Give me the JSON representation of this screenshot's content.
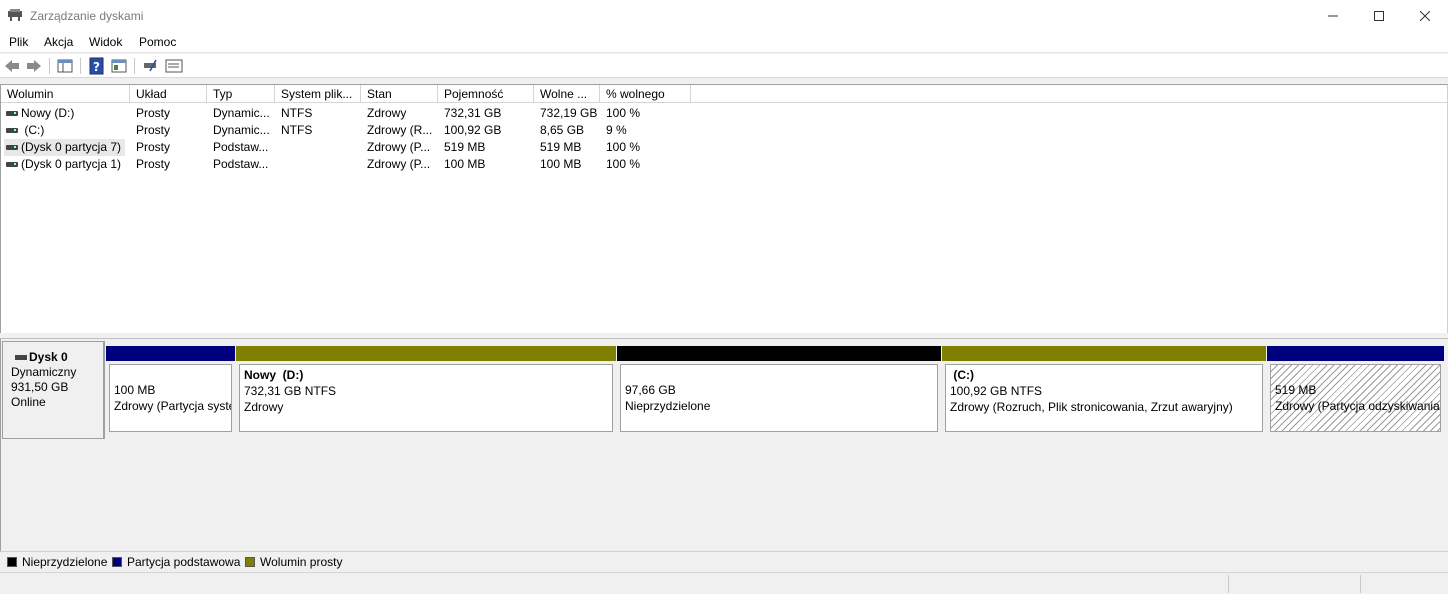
{
  "window": {
    "title": "Zarządzanie dyskami"
  },
  "menu": [
    "Plik",
    "Akcja",
    "Widok",
    "Pomoc"
  ],
  "toolbar_icons": [
    "back-arrow-icon",
    "forward-arrow-icon",
    "console-tree-icon",
    "help-icon",
    "properties-icon",
    "disk-connect-icon",
    "volume-list-icon"
  ],
  "columns": [
    "Wolumin",
    "Układ",
    "Typ",
    "System plik...",
    "Stan",
    "Pojemność",
    "Wolne ...",
    "% wolnego"
  ],
  "volumes": [
    {
      "name": "Nowy (D:)",
      "layout": "Prosty",
      "type": "Dynamic...",
      "fs": "NTFS",
      "status": "Zdrowy",
      "capacity": "732,31 GB",
      "free": "732,19 GB",
      "pct": "100 %"
    },
    {
      "name": " (C:)",
      "layout": "Prosty",
      "type": "Dynamic...",
      "fs": "NTFS",
      "status": "Zdrowy (R...",
      "capacity": "100,92 GB",
      "free": "8,65 GB",
      "pct": "9 %"
    },
    {
      "name": "(Dysk 0 partycja 7)",
      "layout": "Prosty",
      "type": "Podstaw...",
      "fs": "",
      "status": "Zdrowy (P...",
      "capacity": "519 MB",
      "free": "519 MB",
      "pct": "100 %"
    },
    {
      "name": "(Dysk 0 partycja 1)",
      "layout": "Prosty",
      "type": "Podstaw...",
      "fs": "",
      "status": "Zdrowy (P...",
      "capacity": "100 MB",
      "free": "100 MB",
      "pct": "100 %"
    }
  ],
  "disk": {
    "name": "Dysk 0",
    "type": "Dynamiczny",
    "size": "931,50 GB",
    "state": "Online"
  },
  "partitions": [
    {
      "name": "",
      "size": "100 MB",
      "status": "Zdrowy (Partycja systemowa EFI)",
      "color": "#00007f"
    },
    {
      "name": "Nowy  (D:)",
      "size": "732,31 GB NTFS",
      "status": "Zdrowy",
      "color": "#7f7f00"
    },
    {
      "name": "",
      "size": "97,66 GB",
      "status": "Nieprzydzielone",
      "color": "#000000"
    },
    {
      "name": " (C:)",
      "size": "100,92 GB NTFS",
      "status": "Zdrowy (Rozruch, Plik stronicowania, Zrzut awaryjny)",
      "color": "#7f7f00"
    },
    {
      "name": "",
      "size": "519 MB",
      "status": "Zdrowy (Partycja odzyskiwania)",
      "color": "#00007f"
    }
  ],
  "legend": [
    {
      "label": "Nieprzydzielone",
      "color": "#000000"
    },
    {
      "label": "Partycja podstawowa",
      "color": "#00007f"
    },
    {
      "label": "Wolumin prosty",
      "color": "#7f7f00"
    }
  ]
}
